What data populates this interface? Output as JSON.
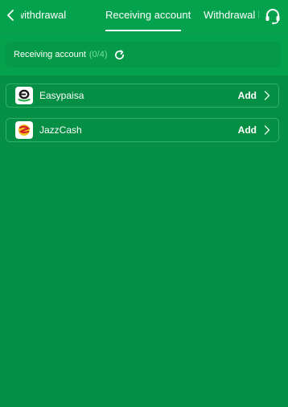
{
  "header": {
    "tabs": [
      {
        "label": "st withdrawal"
      },
      {
        "label": "Receiving account"
      },
      {
        "label": "Withdrawal l"
      }
    ],
    "active_tab": "Receiving account"
  },
  "status": {
    "label": "Receiving account",
    "count": "(0/4)"
  },
  "accounts": [
    {
      "name": "Easypaisa",
      "action": "Add",
      "logo": "easypaisa-logo"
    },
    {
      "name": "JazzCash",
      "action": "Add",
      "logo": "jazzcash-logo"
    }
  ],
  "icons": {
    "back": "chevron-left-icon",
    "support": "headset-icon",
    "refresh": "refresh-icon",
    "row_arrow": "chevron-right-icon"
  },
  "colors": {
    "background": "#058f44",
    "header": "#05a24e",
    "count_accent": "#74e09f"
  }
}
